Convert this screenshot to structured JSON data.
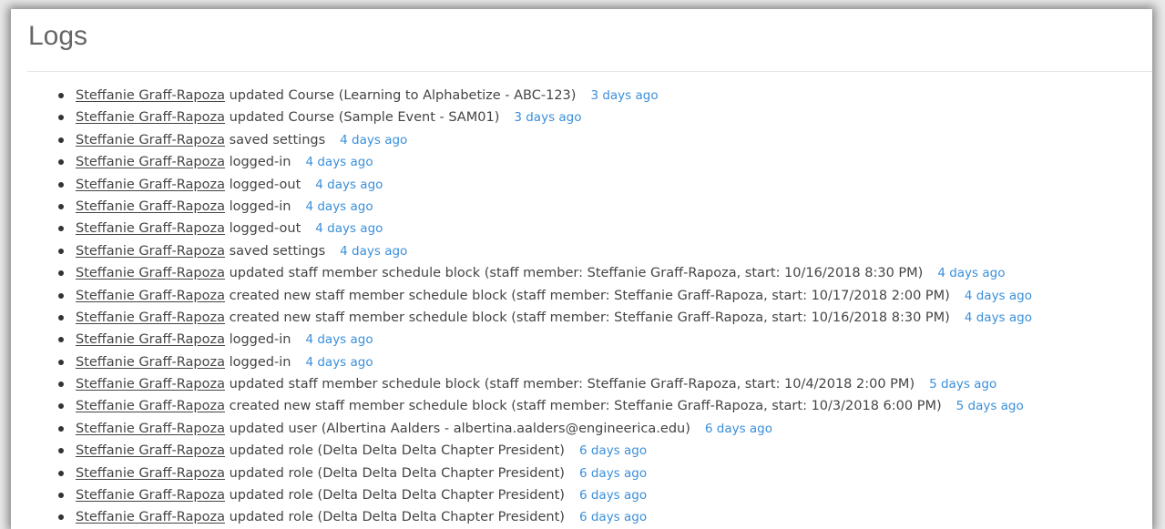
{
  "page": {
    "title": "Logs"
  },
  "logs": [
    {
      "user": "Steffanie Graff-Rapoza",
      "action": "updated Course (Learning to Alphabetize - ABC-123)",
      "time": "3 days ago"
    },
    {
      "user": "Steffanie Graff-Rapoza",
      "action": "updated Course (Sample Event - SAM01)",
      "time": "3 days ago"
    },
    {
      "user": "Steffanie Graff-Rapoza",
      "action": "saved settings",
      "time": "4 days ago"
    },
    {
      "user": "Steffanie Graff-Rapoza",
      "action": "logged-in",
      "time": "4 days ago"
    },
    {
      "user": "Steffanie Graff-Rapoza",
      "action": "logged-out",
      "time": "4 days ago"
    },
    {
      "user": "Steffanie Graff-Rapoza",
      "action": "logged-in",
      "time": "4 days ago"
    },
    {
      "user": "Steffanie Graff-Rapoza",
      "action": "logged-out",
      "time": "4 days ago"
    },
    {
      "user": "Steffanie Graff-Rapoza",
      "action": "saved settings",
      "time": "4 days ago"
    },
    {
      "user": "Steffanie Graff-Rapoza",
      "action": "updated staff member schedule block (staff member: Steffanie Graff-Rapoza, start: 10/16/2018 8:30 PM)",
      "time": "4 days ago"
    },
    {
      "user": "Steffanie Graff-Rapoza",
      "action": "created new staff member schedule block (staff member: Steffanie Graff-Rapoza, start: 10/17/2018 2:00 PM)",
      "time": "4 days ago"
    },
    {
      "user": "Steffanie Graff-Rapoza",
      "action": "created new staff member schedule block (staff member: Steffanie Graff-Rapoza, start: 10/16/2018 8:30 PM)",
      "time": "4 days ago"
    },
    {
      "user": "Steffanie Graff-Rapoza",
      "action": "logged-in",
      "time": "4 days ago"
    },
    {
      "user": "Steffanie Graff-Rapoza",
      "action": "logged-in",
      "time": "4 days ago"
    },
    {
      "user": "Steffanie Graff-Rapoza",
      "action": "updated staff member schedule block (staff member: Steffanie Graff-Rapoza, start: 10/4/2018 2:00 PM)",
      "time": "5 days ago"
    },
    {
      "user": "Steffanie Graff-Rapoza",
      "action": "created new staff member schedule block (staff member: Steffanie Graff-Rapoza, start: 10/3/2018 6:00 PM)",
      "time": "5 days ago"
    },
    {
      "user": "Steffanie Graff-Rapoza",
      "action": "updated user (Albertina Aalders - albertina.aalders@engineerica.edu)",
      "time": "6 days ago"
    },
    {
      "user": "Steffanie Graff-Rapoza",
      "action": "updated role (Delta Delta Delta Chapter President)",
      "time": "6 days ago"
    },
    {
      "user": "Steffanie Graff-Rapoza",
      "action": "updated role (Delta Delta Delta Chapter President)",
      "time": "6 days ago"
    },
    {
      "user": "Steffanie Graff-Rapoza",
      "action": "updated role (Delta Delta Delta Chapter President)",
      "time": "6 days ago"
    },
    {
      "user": "Steffanie Graff-Rapoza",
      "action": "updated role (Delta Delta Delta Chapter President)",
      "time": "6 days ago"
    }
  ],
  "colors": {
    "link_blue": "#3b8fd9",
    "text": "#444444",
    "title": "#666666"
  }
}
